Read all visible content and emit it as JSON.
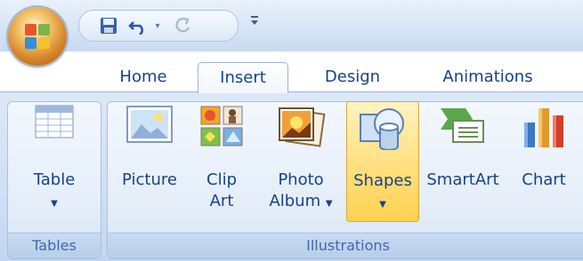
{
  "quick_access": {
    "save_icon": "save-icon",
    "undo_icon": "undo-icon",
    "redo_icon": "redo-icon",
    "customize_icon": "customize-qat-icon"
  },
  "tabs": [
    {
      "label": "Home"
    },
    {
      "label": "Insert"
    },
    {
      "label": "Design"
    },
    {
      "label": "Animations"
    }
  ],
  "groups": {
    "tables": {
      "label": "Tables",
      "table_label": "Table"
    },
    "illustrations": {
      "label": "Illustrations",
      "picture_label": "Picture",
      "clipart_line1": "Clip",
      "clipart_line2": "Art",
      "photo_line1": "Photo",
      "photo_line2": "Album",
      "shapes_label": "Shapes",
      "smartart_label": "SmartArt",
      "chart_label": "Chart"
    }
  },
  "colors": {
    "tab_text": "#15428b",
    "highlight": "#ffd24f"
  }
}
